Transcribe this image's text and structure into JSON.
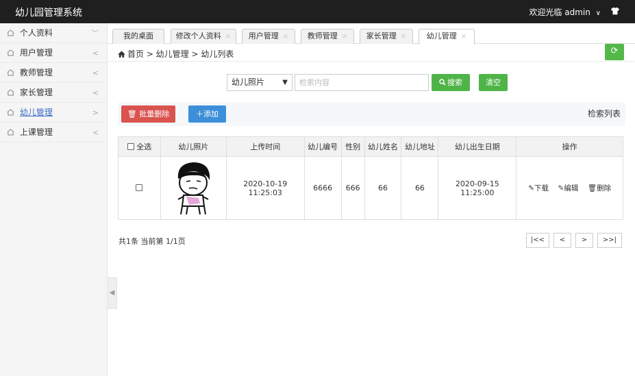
{
  "app": {
    "title": "幼儿园管理系统",
    "welcome": "欢迎光临",
    "user": "admin"
  },
  "sidebar": {
    "items": [
      {
        "label": "个人资料",
        "arrow": "﹀"
      },
      {
        "label": "用户管理",
        "arrow": "<"
      },
      {
        "label": "教师管理",
        "arrow": "<"
      },
      {
        "label": "家长管理",
        "arrow": "<"
      },
      {
        "label": "幼儿管理",
        "arrow": ">"
      },
      {
        "label": "上课管理",
        "arrow": "<"
      }
    ]
  },
  "tabs": [
    {
      "label": "我的桌面",
      "close": ""
    },
    {
      "label": "修改个人资料",
      "close": "×"
    },
    {
      "label": "用户管理",
      "close": "×"
    },
    {
      "label": "教师管理",
      "close": "×"
    },
    {
      "label": "家长管理",
      "close": "×"
    },
    {
      "label": "幼儿管理",
      "close": "×"
    }
  ],
  "breadcrumb": {
    "text": "首页 > 幼儿管理 > 幼儿列表"
  },
  "search": {
    "select_value": "幼儿照片",
    "placeholder": "检索内容",
    "search_label": "搜索",
    "clear_label": "清空"
  },
  "actions": {
    "batch_delete": "批量删除",
    "add": "添加",
    "list_title": "检索列表"
  },
  "table": {
    "headers": [
      "全选",
      "幼儿照片",
      "上传时间",
      "幼儿编号",
      "性别",
      "幼儿姓名",
      "幼儿地址",
      "幼儿出生日期",
      "操作"
    ],
    "rows": [
      {
        "upload_time": "2020-10-19 11:25:03",
        "child_no": "6666",
        "gender": "666",
        "name": "66",
        "address": "66",
        "birth": "2020-09-15 11:25:00"
      }
    ],
    "ops": {
      "download": "下载",
      "edit": "编辑",
      "delete": "删除"
    }
  },
  "pagination": {
    "summary": "共1条   当前第 1/1页",
    "first": "|<<",
    "prev": "<",
    "next": ">",
    "last": ">>|"
  },
  "colors": {
    "topbar": "#1f1f1f",
    "green": "#4fb447",
    "red": "#d9534f",
    "blue": "#3c8fd8",
    "active_link": "#3a6bc7"
  }
}
